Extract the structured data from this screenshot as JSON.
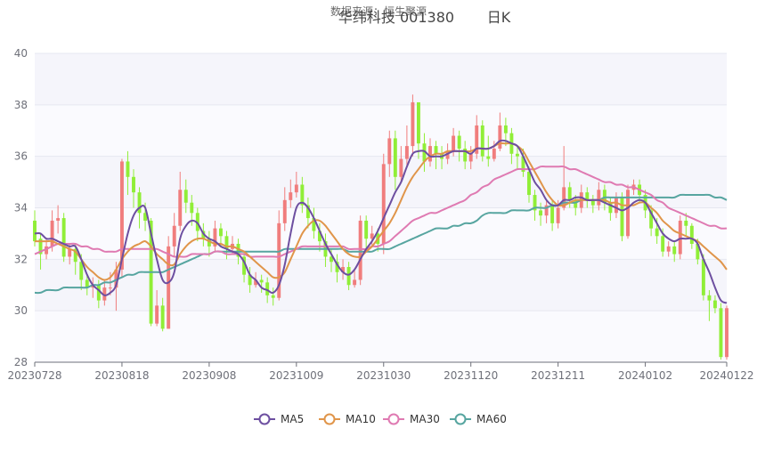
{
  "header": {
    "source": "数据来源：恒生聚源",
    "title": "华纬科技 001380",
    "period": "日K"
  },
  "colors": {
    "up": "#f07d7d",
    "down": "#90ee37",
    "ma5": "#6d4fa0",
    "ma10": "#e0954a",
    "ma30": "#df7ab2",
    "ma60": "#57a5a0",
    "plot_bg": "#f5f5fb"
  },
  "chart_data": {
    "type": "candlestick",
    "ylim": [
      28,
      40
    ],
    "yticks": [
      28,
      30,
      32,
      34,
      36,
      38,
      40
    ],
    "xticks": [
      {
        "label": "20230728",
        "index": 0
      },
      {
        "label": "20230818",
        "index": 15
      },
      {
        "label": "20230908",
        "index": 30
      },
      {
        "label": "20231009",
        "index": 45
      },
      {
        "label": "20231030",
        "index": 60
      },
      {
        "label": "20231120",
        "index": 75
      },
      {
        "label": "20231211",
        "index": 90
      },
      {
        "label": "20240102",
        "index": 105
      },
      {
        "label": "20240122",
        "index": 119
      }
    ],
    "n": 120,
    "legend": [
      "MA5",
      "MA10",
      "MA30",
      "MA60"
    ],
    "candles": [
      [
        33.5,
        32.7,
        33.9,
        32.5
      ],
      [
        32.8,
        32.2,
        33.0,
        31.6
      ],
      [
        32.2,
        32.5,
        32.8,
        32.0
      ],
      [
        32.5,
        33.5,
        33.9,
        32.3
      ],
      [
        33.5,
        33.6,
        34.1,
        33.0
      ],
      [
        33.6,
        32.1,
        33.8,
        31.9
      ],
      [
        32.1,
        32.4,
        32.6,
        31.8
      ],
      [
        32.4,
        31.9,
        32.6,
        31.4
      ],
      [
        31.9,
        31.2,
        32.2,
        30.8
      ],
      [
        31.2,
        30.9,
        31.4,
        30.6
      ],
      [
        30.9,
        31.0,
        31.3,
        30.5
      ],
      [
        31.0,
        30.4,
        31.2,
        30.1
      ],
      [
        30.4,
        30.9,
        31.2,
        30.2
      ],
      [
        30.9,
        30.9,
        31.5,
        30.6
      ],
      [
        30.9,
        31.6,
        31.9,
        30.0
      ],
      [
        31.6,
        35.8,
        35.9,
        31.3
      ],
      [
        35.8,
        35.2,
        36.2,
        34.5
      ],
      [
        35.2,
        34.6,
        35.5,
        34.0
      ],
      [
        34.6,
        33.8,
        34.8,
        33.2
      ],
      [
        33.8,
        33.5,
        34.2,
        33.1
      ],
      [
        33.5,
        29.5,
        33.6,
        29.4
      ],
      [
        29.5,
        30.2,
        30.8,
        29.4
      ],
      [
        30.2,
        29.3,
        30.5,
        29.2
      ],
      [
        29.3,
        32.5,
        32.9,
        29.3
      ],
      [
        32.5,
        33.3,
        33.8,
        32.1
      ],
      [
        33.3,
        34.7,
        35.4,
        33.1
      ],
      [
        34.7,
        34.2,
        35.1,
        33.8
      ],
      [
        34.2,
        33.8,
        34.5,
        33.3
      ],
      [
        33.8,
        33.1,
        34.0,
        32.7
      ],
      [
        33.1,
        32.8,
        33.4,
        32.5
      ],
      [
        32.8,
        32.5,
        33.1,
        32.1
      ],
      [
        32.5,
        33.2,
        33.5,
        32.3
      ],
      [
        33.2,
        32.9,
        33.4,
        32.5
      ],
      [
        32.9,
        32.4,
        33.1,
        32.0
      ],
      [
        32.4,
        32.6,
        32.9,
        32.2
      ],
      [
        32.6,
        32.1,
        32.8,
        31.8
      ],
      [
        32.1,
        31.4,
        32.3,
        31.1
      ],
      [
        31.4,
        31.0,
        31.7,
        30.7
      ],
      [
        31.0,
        31.2,
        31.5,
        30.9
      ],
      [
        31.2,
        31.1,
        31.4,
        30.7
      ],
      [
        31.1,
        30.6,
        31.3,
        30.3
      ],
      [
        30.6,
        30.5,
        30.9,
        30.2
      ],
      [
        30.5,
        33.4,
        33.9,
        30.4
      ],
      [
        33.4,
        34.3,
        34.8,
        33.1
      ],
      [
        34.3,
        34.6,
        35.1,
        34.0
      ],
      [
        34.6,
        34.9,
        35.4,
        34.4
      ],
      [
        34.9,
        34.1,
        35.2,
        33.8
      ],
      [
        34.1,
        33.6,
        34.4,
        33.2
      ],
      [
        33.6,
        33.1,
        34.0,
        32.8
      ],
      [
        33.1,
        32.7,
        33.4,
        32.3
      ],
      [
        32.7,
        32.1,
        33.0,
        31.7
      ],
      [
        32.1,
        31.9,
        32.4,
        31.5
      ],
      [
        31.9,
        31.5,
        32.2,
        31.1
      ],
      [
        31.5,
        31.7,
        32.0,
        31.2
      ],
      [
        31.7,
        31.0,
        31.9,
        30.8
      ],
      [
        31.0,
        31.2,
        31.6,
        30.9
      ],
      [
        31.2,
        33.5,
        33.7,
        31.0
      ],
      [
        33.5,
        32.8,
        33.7,
        32.4
      ],
      [
        32.8,
        33.0,
        33.3,
        32.5
      ],
      [
        33.0,
        32.6,
        33.2,
        32.3
      ],
      [
        32.6,
        35.7,
        36.1,
        32.2
      ],
      [
        35.7,
        36.7,
        37.0,
        35.2
      ],
      [
        36.7,
        35.2,
        37.0,
        34.7
      ],
      [
        35.2,
        35.9,
        36.4,
        35.0
      ],
      [
        35.9,
        36.4,
        37.2,
        35.6
      ],
      [
        36.4,
        38.1,
        38.4,
        36.0
      ],
      [
        38.1,
        36.5,
        37.8,
        35.9
      ],
      [
        36.5,
        35.8,
        36.9,
        35.4
      ],
      [
        35.8,
        36.4,
        36.7,
        35.6
      ],
      [
        36.4,
        36.1,
        36.6,
        35.5
      ],
      [
        36.1,
        35.9,
        36.4,
        35.5
      ],
      [
        35.9,
        36.2,
        36.5,
        35.7
      ],
      [
        36.2,
        36.8,
        37.1,
        36.0
      ],
      [
        36.8,
        36.3,
        37.0,
        35.8
      ],
      [
        36.3,
        35.8,
        36.6,
        35.5
      ],
      [
        35.8,
        36.1,
        36.4,
        35.5
      ],
      [
        36.1,
        37.2,
        37.6,
        35.9
      ],
      [
        37.2,
        36.0,
        37.4,
        35.8
      ],
      [
        36.0,
        35.9,
        36.8,
        35.6
      ],
      [
        35.9,
        36.3,
        36.6,
        35.8
      ],
      [
        36.3,
        37.2,
        37.7,
        36.2
      ],
      [
        37.2,
        36.9,
        37.5,
        36.4
      ],
      [
        36.9,
        36.1,
        37.1,
        35.7
      ],
      [
        36.1,
        36.0,
        36.4,
        35.5
      ],
      [
        36.0,
        35.4,
        36.3,
        35.2
      ],
      [
        35.4,
        34.5,
        35.6,
        34.2
      ],
      [
        34.5,
        33.9,
        34.7,
        33.5
      ],
      [
        33.9,
        33.7,
        34.2,
        33.3
      ],
      [
        33.7,
        34.1,
        34.3,
        33.4
      ],
      [
        34.1,
        33.4,
        34.3,
        33.1
      ],
      [
        33.4,
        34.0,
        34.3,
        33.2
      ],
      [
        34.0,
        34.8,
        36.4,
        33.9
      ],
      [
        34.8,
        34.3,
        35.0,
        34.0
      ],
      [
        34.3,
        34.0,
        34.5,
        33.7
      ],
      [
        34.0,
        34.6,
        34.9,
        33.8
      ],
      [
        34.6,
        34.3,
        34.8,
        34.0
      ],
      [
        34.3,
        34.1,
        34.5,
        33.8
      ],
      [
        34.1,
        34.7,
        35.0,
        33.9
      ],
      [
        34.7,
        34.2,
        34.9,
        33.9
      ],
      [
        34.2,
        33.8,
        34.4,
        33.5
      ],
      [
        33.8,
        34.4,
        34.6,
        33.6
      ],
      [
        34.4,
        32.9,
        34.6,
        32.7
      ],
      [
        32.9,
        34.7,
        34.9,
        32.8
      ],
      [
        34.7,
        34.9,
        35.1,
        34.5
      ],
      [
        34.9,
        34.5,
        35.1,
        34.2
      ],
      [
        34.5,
        33.9,
        34.7,
        33.6
      ],
      [
        33.9,
        33.2,
        34.1,
        32.9
      ],
      [
        33.2,
        32.9,
        33.6,
        32.6
      ],
      [
        32.9,
        32.3,
        33.2,
        32.1
      ],
      [
        32.3,
        32.5,
        32.7,
        32.1
      ],
      [
        32.5,
        32.2,
        32.7,
        31.9
      ],
      [
        32.2,
        33.5,
        33.7,
        32.0
      ],
      [
        33.5,
        33.3,
        33.8,
        32.9
      ],
      [
        33.3,
        32.6,
        33.4,
        32.4
      ],
      [
        32.6,
        32.0,
        32.8,
        31.8
      ],
      [
        32.0,
        30.6,
        32.2,
        30.4
      ],
      [
        30.6,
        30.4,
        30.8,
        29.6
      ],
      [
        30.4,
        30.1,
        30.6,
        29.9
      ],
      [
        30.1,
        28.2,
        30.3,
        28.1
      ],
      [
        28.2,
        30.1,
        30.2,
        28.1
      ]
    ],
    "ma5": [
      33.0,
      33.0,
      32.8,
      32.8,
      32.7,
      32.6,
      32.5,
      32.5,
      32.0,
      31.4,
      31.0,
      30.8,
      30.6,
      30.7,
      31.0,
      32.0,
      33.0,
      33.7,
      34.0,
      34.0,
      33.0,
      32.0,
      31.2,
      31.1,
      31.5,
      32.8,
      33.3,
      33.5,
      33.4,
      33.0,
      32.8,
      32.7,
      32.5,
      32.4,
      32.3,
      32.2,
      31.9,
      31.4,
      31.2,
      30.9,
      30.8,
      30.7,
      31.0,
      31.8,
      33.0,
      34.0,
      34.2,
      34.0,
      33.6,
      33.1,
      32.6,
      32.2,
      31.8,
      31.5,
      31.4,
      31.6,
      32.0,
      32.4,
      32.7,
      33.1,
      33.6,
      34.1,
      34.6,
      35.0,
      35.6,
      36.1,
      36.2,
      36.2,
      36.0,
      36.0,
      36.0,
      36.1,
      36.2,
      36.2,
      36.2,
      36.1,
      36.3,
      36.3,
      36.3,
      36.4,
      36.6,
      36.6,
      36.5,
      36.4,
      36.0,
      35.5,
      35.0,
      34.7,
      34.3,
      34.1,
      34.1,
      34.3,
      34.3,
      34.4,
      34.4,
      34.3,
      34.3,
      34.3,
      34.2,
      34.1,
      34.0,
      33.9,
      34.0,
      34.2,
      34.3,
      34.2,
      33.8,
      33.4,
      33.0,
      32.8,
      32.7,
      32.8,
      32.8,
      32.8,
      32.6,
      32.0,
      31.5,
      30.9,
      30.4,
      30.3
    ],
    "ma10": [
      32.7,
      32.7,
      32.7,
      32.7,
      32.6,
      32.5,
      32.4,
      32.3,
      32.0,
      31.7,
      31.5,
      31.3,
      31.2,
      31.3,
      31.6,
      32.0,
      32.3,
      32.5,
      32.6,
      32.7,
      32.5,
      32.2,
      32.0,
      31.8,
      31.8,
      32.2,
      32.5,
      32.7,
      32.8,
      32.8,
      32.7,
      32.6,
      32.6,
      32.5,
      32.5,
      32.4,
      32.3,
      32.1,
      31.9,
      31.7,
      31.5,
      31.3,
      31.3,
      31.5,
      32.0,
      32.5,
      33.0,
      33.3,
      33.5,
      33.5,
      33.3,
      33.0,
      32.7,
      32.4,
      32.2,
      32.1,
      32.1,
      32.3,
      32.5,
      32.8,
      33.1,
      33.4,
      33.8,
      34.3,
      34.8,
      35.2,
      35.5,
      35.8,
      36.0,
      36.1,
      36.1,
      36.2,
      36.2,
      36.2,
      36.2,
      36.2,
      36.3,
      36.3,
      36.3,
      36.4,
      36.5,
      36.5,
      36.5,
      36.4,
      36.2,
      35.8,
      35.4,
      35.0,
      34.6,
      34.3,
      34.1,
      34.1,
      34.2,
      34.3,
      34.3,
      34.3,
      34.3,
      34.3,
      34.3,
      34.2,
      34.2,
      34.1,
      34.1,
      34.1,
      34.2,
      34.2,
      34.0,
      33.8,
      33.5,
      33.3,
      33.1,
      33.0,
      32.9,
      32.8,
      32.7,
      32.5,
      32.3,
      32.1,
      31.9,
      31.6
    ],
    "ma30": [
      32.2,
      32.3,
      32.4,
      32.5,
      32.6,
      32.6,
      32.6,
      32.6,
      32.5,
      32.5,
      32.4,
      32.4,
      32.3,
      32.3,
      32.3,
      32.4,
      32.4,
      32.4,
      32.4,
      32.4,
      32.4,
      32.4,
      32.3,
      32.2,
      32.1,
      32.1,
      32.1,
      32.2,
      32.2,
      32.2,
      32.2,
      32.3,
      32.3,
      32.2,
      32.2,
      32.2,
      32.2,
      32.1,
      32.1,
      32.1,
      32.1,
      32.1,
      32.1,
      32.2,
      32.3,
      32.4,
      32.5,
      32.5,
      32.5,
      32.5,
      32.5,
      32.5,
      32.5,
      32.5,
      32.4,
      32.4,
      32.4,
      32.4,
      32.5,
      32.5,
      32.6,
      32.7,
      32.9,
      33.1,
      33.3,
      33.5,
      33.6,
      33.7,
      33.8,
      33.8,
      33.9,
      34.0,
      34.1,
      34.2,
      34.3,
      34.5,
      34.6,
      34.8,
      34.9,
      35.1,
      35.2,
      35.3,
      35.4,
      35.5,
      35.5,
      35.5,
      35.5,
      35.6,
      35.6,
      35.6,
      35.6,
      35.6,
      35.5,
      35.5,
      35.4,
      35.3,
      35.2,
      35.1,
      35.0,
      35.0,
      34.9,
      34.9,
      34.8,
      34.8,
      34.7,
      34.6,
      34.5,
      34.3,
      34.2,
      34.0,
      33.9,
      33.8,
      33.7,
      33.6,
      33.5,
      33.4,
      33.3,
      33.3,
      33.2,
      33.2
    ],
    "ma60": [
      30.7,
      30.7,
      30.8,
      30.8,
      30.8,
      30.9,
      30.9,
      30.9,
      30.9,
      30.9,
      31.0,
      31.0,
      31.1,
      31.1,
      31.2,
      31.3,
      31.4,
      31.4,
      31.5,
      31.5,
      31.5,
      31.5,
      31.5,
      31.6,
      31.7,
      31.8,
      31.9,
      32.0,
      32.1,
      32.2,
      32.2,
      32.3,
      32.3,
      32.3,
      32.3,
      32.3,
      32.3,
      32.3,
      32.3,
      32.3,
      32.3,
      32.3,
      32.3,
      32.4,
      32.4,
      32.4,
      32.4,
      32.4,
      32.4,
      32.4,
      32.4,
      32.4,
      32.4,
      32.4,
      32.3,
      32.3,
      32.3,
      32.3,
      32.3,
      32.4,
      32.4,
      32.4,
      32.5,
      32.6,
      32.7,
      32.8,
      32.9,
      33.0,
      33.1,
      33.2,
      33.2,
      33.2,
      33.3,
      33.3,
      33.4,
      33.4,
      33.5,
      33.7,
      33.8,
      33.8,
      33.8,
      33.8,
      33.9,
      33.9,
      33.9,
      33.9,
      34.0,
      34.0,
      34.0,
      34.1,
      34.1,
      34.2,
      34.2,
      34.2,
      34.3,
      34.3,
      34.3,
      34.3,
      34.4,
      34.4,
      34.4,
      34.4,
      34.4,
      34.4,
      34.4,
      34.4,
      34.4,
      34.4,
      34.4,
      34.4,
      34.4,
      34.5,
      34.5,
      34.5,
      34.5,
      34.5,
      34.5,
      34.4,
      34.4,
      34.3
    ]
  }
}
